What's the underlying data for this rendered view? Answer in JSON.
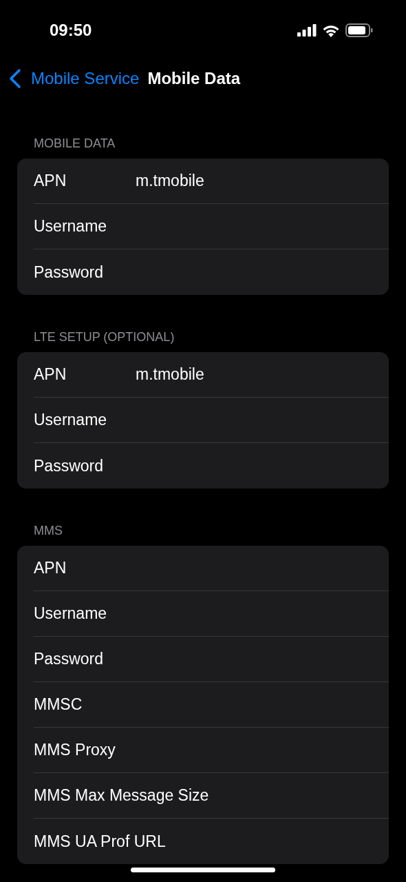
{
  "status_bar": {
    "time": "09:50"
  },
  "nav": {
    "back_label": "Mobile Service",
    "title": "Mobile Data"
  },
  "sections": [
    {
      "header": "MOBILE DATA",
      "rows": [
        {
          "label": "APN",
          "value": "m.tmobile"
        },
        {
          "label": "Username"
        },
        {
          "label": "Password"
        }
      ]
    },
    {
      "header": "LTE SETUP (OPTIONAL)",
      "rows": [
        {
          "label": "APN",
          "value": "m.tmobile"
        },
        {
          "label": "Username"
        },
        {
          "label": "Password"
        }
      ]
    },
    {
      "header": "MMS",
      "rows": [
        {
          "label": "APN"
        },
        {
          "label": "Username"
        },
        {
          "label": "Password"
        },
        {
          "label": "MMSC"
        },
        {
          "label": "MMS Proxy"
        },
        {
          "label": "MMS Max Message Size"
        },
        {
          "label": "MMS UA Prof URL"
        }
      ]
    }
  ]
}
